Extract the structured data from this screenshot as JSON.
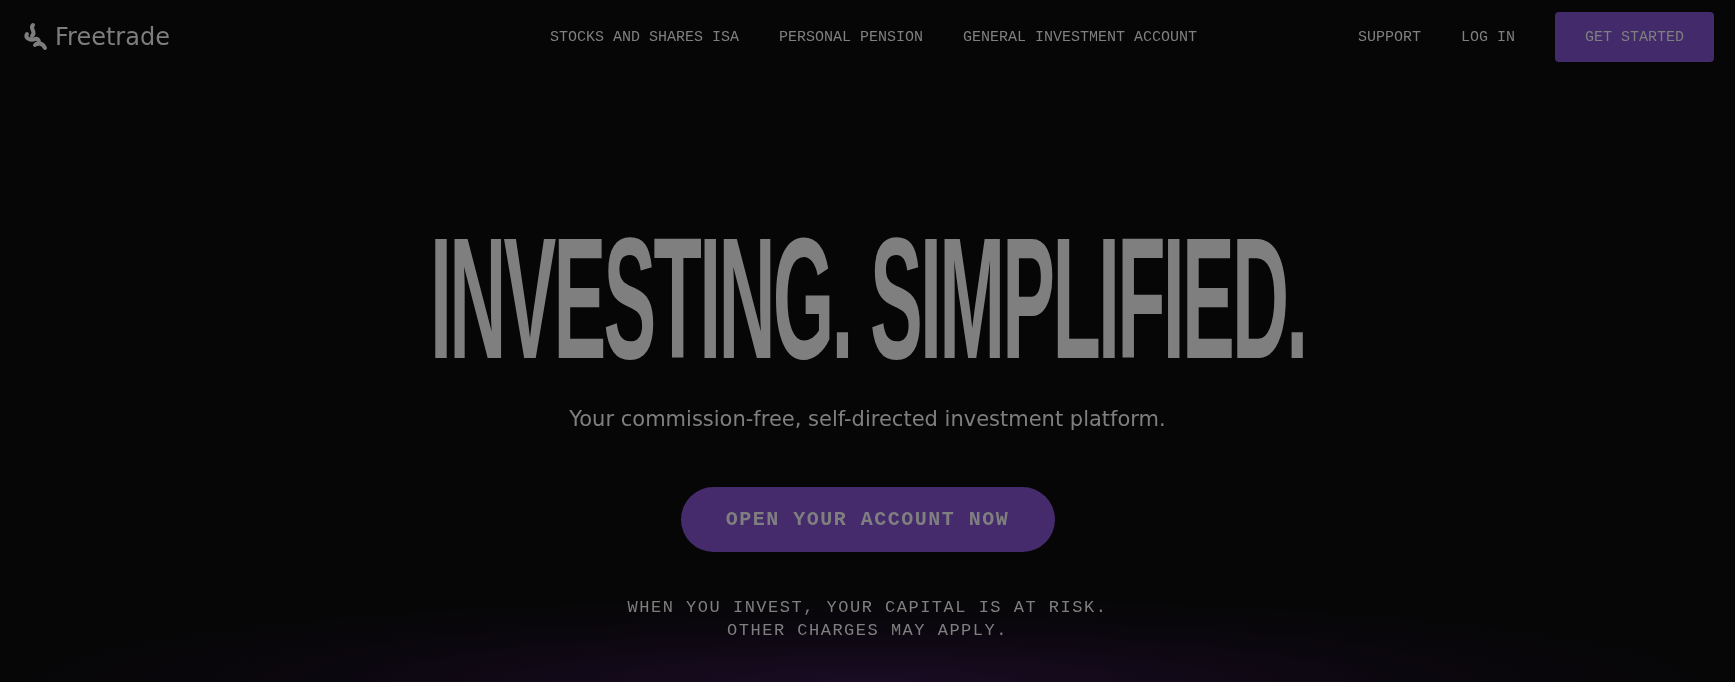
{
  "header": {
    "logo": "Freetrade",
    "nav": [
      "STOCKS AND SHARES ISA",
      "PERSONAL PENSION",
      "GENERAL INVESTMENT ACCOUNT"
    ],
    "links": [
      "SUPPORT",
      "LOG IN"
    ],
    "cta": "GET STARTED"
  },
  "hero": {
    "headline": "INVESTING. SIMPLIFIED.",
    "subtitle": "Your commission-free, self-directed investment platform.",
    "button": "OPEN YOUR ACCOUNT NOW",
    "disclaimer": [
      "WHEN YOU INVEST, YOUR CAPITAL IS AT RISK.",
      "OTHER CHARGES MAY APPLY."
    ]
  }
}
